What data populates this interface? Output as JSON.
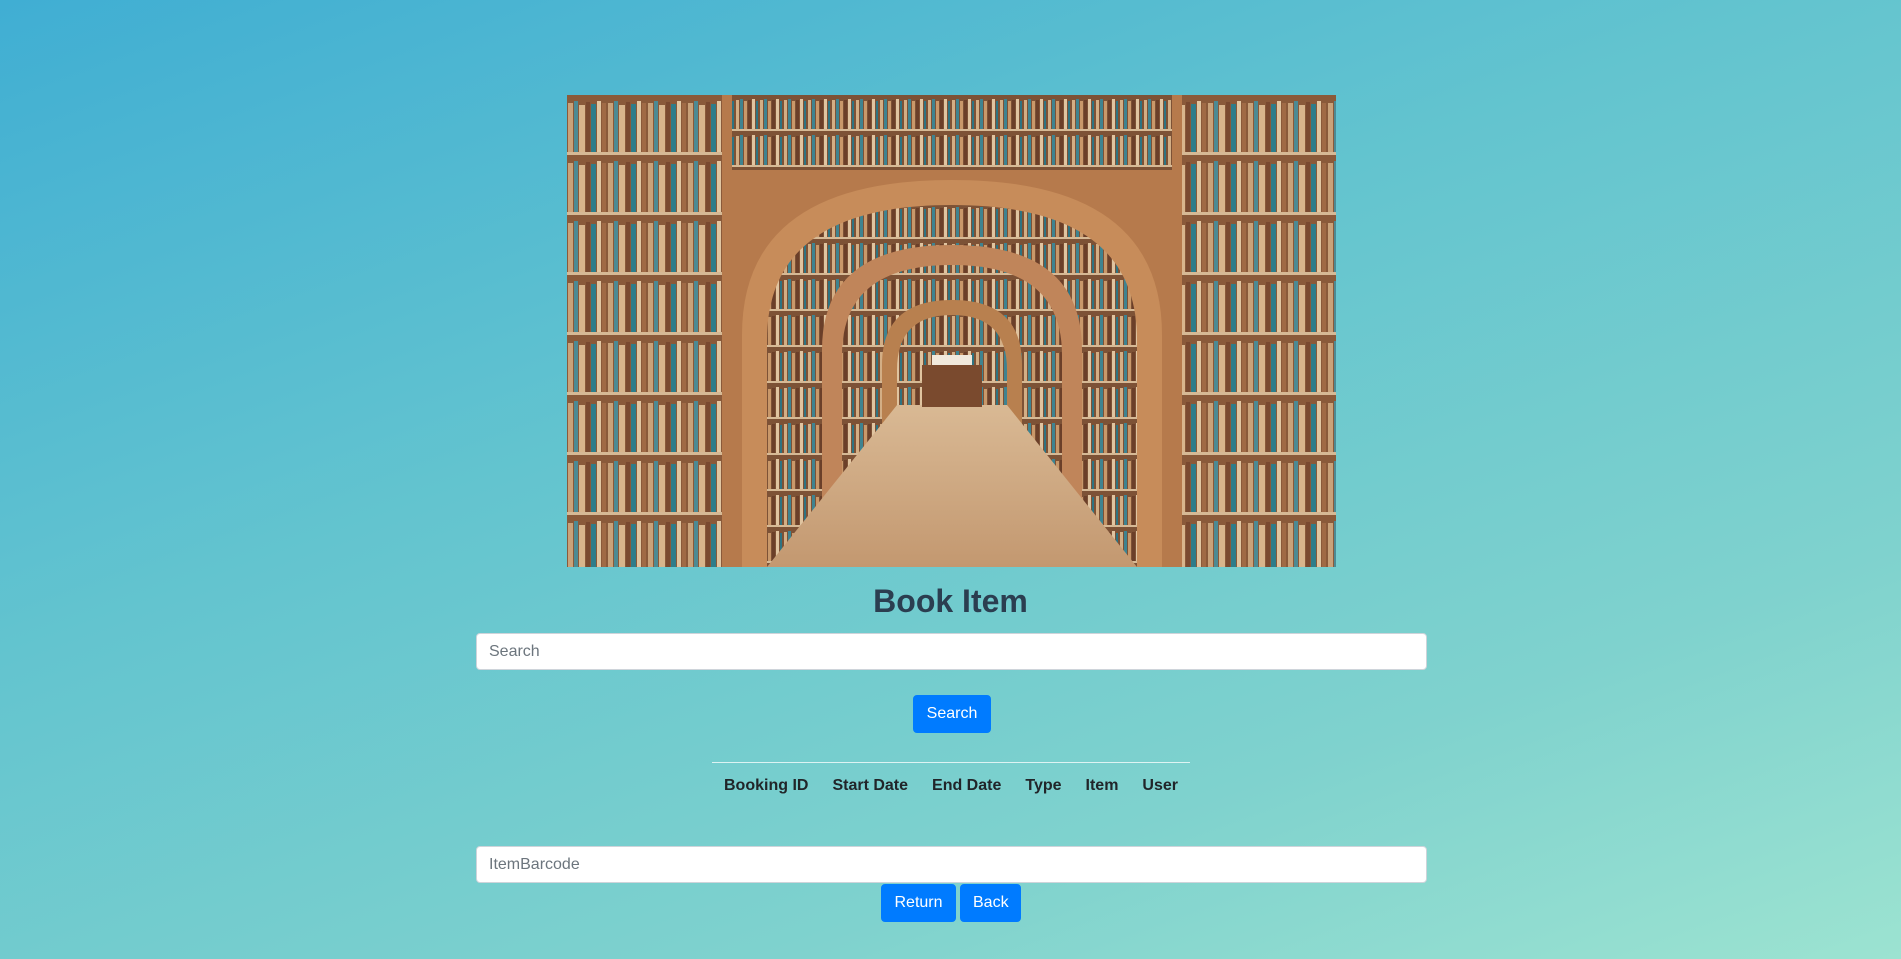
{
  "page": {
    "title": "Book Item"
  },
  "search": {
    "placeholder": "Search",
    "value": "",
    "button_label": "Search"
  },
  "bookings_table": {
    "columns": [
      "Booking ID",
      "Start Date",
      "End Date",
      "Type",
      "Item",
      "User"
    ],
    "rows": []
  },
  "return_form": {
    "barcode_placeholder": "ItemBarcode",
    "barcode_value": "",
    "return_label": "Return",
    "back_label": "Back"
  },
  "colors": {
    "primary_button": "#007bff",
    "title_text": "#2b3e50",
    "background_start": "#40aed3",
    "background_end": "#9ce3d1"
  }
}
